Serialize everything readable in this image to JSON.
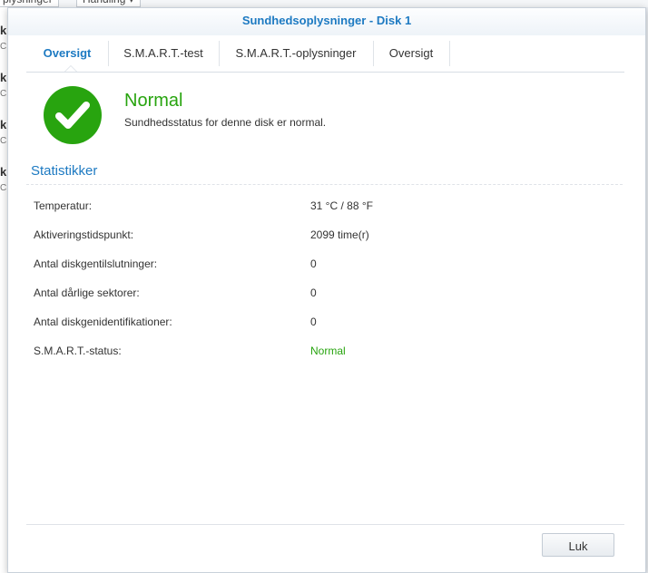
{
  "background": {
    "toolbar": {
      "left_label": "plysninger",
      "right_label": "Handling ▾"
    },
    "list_rows": [
      {
        "title": "k",
        "sub": "C"
      },
      {
        "title": "k",
        "sub": "C"
      },
      {
        "title": "k",
        "sub": "C"
      },
      {
        "title": "k",
        "sub": "C"
      }
    ]
  },
  "dialog": {
    "title": "Sundhedsoplysninger - Disk 1",
    "tabs": [
      {
        "label": "Oversigt",
        "active": true
      },
      {
        "label": "S.M.A.R.T.-test",
        "active": false
      },
      {
        "label": "S.M.A.R.T.-oplysninger",
        "active": false
      },
      {
        "label": "Oversigt",
        "active": false
      }
    ],
    "status": {
      "icon": "check-circle-icon",
      "heading": "Normal",
      "description": "Sundhedsstatus for denne disk er normal."
    },
    "stats": {
      "title": "Statistikker",
      "rows": [
        {
          "label": "Temperatur:",
          "value": "31 °C / 88 °F"
        },
        {
          "label": "Aktiveringstidspunkt:",
          "value": "2099 time(r)"
        },
        {
          "label": "Antal diskgentilslutninger:",
          "value": "0"
        },
        {
          "label": "Antal dårlige sektorer:",
          "value": "0"
        },
        {
          "label": "Antal diskgenidentifikationer:",
          "value": "0"
        },
        {
          "label": "S.M.A.R.T.-status:",
          "value": "Normal"
        }
      ]
    },
    "close_label": "Luk"
  },
  "colors": {
    "accent": "#1d7ac2",
    "status_ok": "#28a40f"
  }
}
